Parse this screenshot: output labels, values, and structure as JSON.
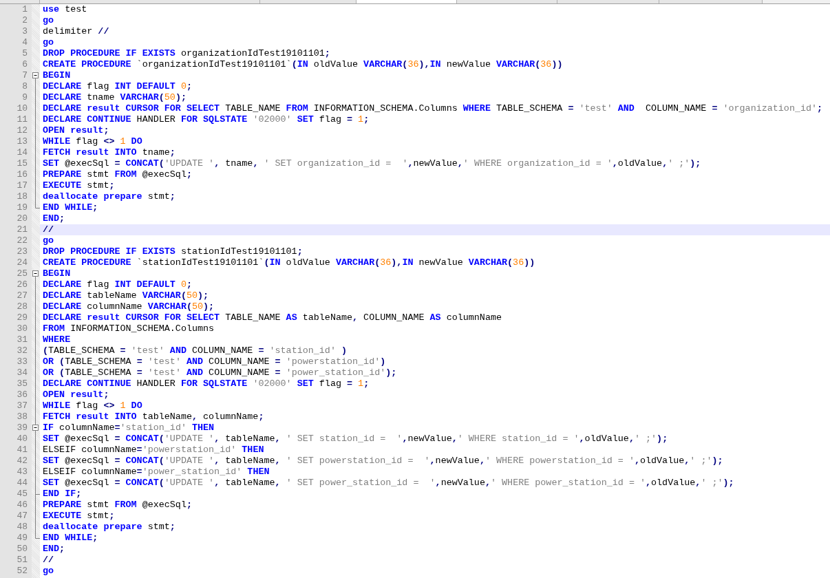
{
  "editor": {
    "lines": [
      {
        "number": "1",
        "highlighted": false,
        "tokens": [
          {
            "kind": "keyword",
            "text": "use"
          },
          {
            "kind": "plain",
            "text": " test"
          }
        ]
      },
      {
        "number": "2",
        "highlighted": false,
        "tokens": [
          {
            "kind": "keyword",
            "text": "go"
          }
        ]
      },
      {
        "number": "3",
        "highlighted": false,
        "tokens": [
          {
            "kind": "plain",
            "text": "delimiter "
          },
          {
            "kind": "operator",
            "text": "//"
          }
        ]
      },
      {
        "number": "4",
        "highlighted": false,
        "tokens": [
          {
            "kind": "keyword",
            "text": "go"
          }
        ]
      },
      {
        "number": "5",
        "highlighted": false,
        "tokens": [
          {
            "kind": "keyword",
            "text": "DROP PROCEDURE IF EXISTS"
          },
          {
            "kind": "plain",
            "text": " organizationIdTest19101101"
          },
          {
            "kind": "operator",
            "text": ";"
          }
        ]
      },
      {
        "number": "6",
        "highlighted": false,
        "tokens": [
          {
            "kind": "keyword",
            "text": "CREATE PROCEDURE"
          },
          {
            "kind": "plain",
            "text": " `organizationIdTest19101101`"
          },
          {
            "kind": "operator",
            "text": "("
          },
          {
            "kind": "keyword",
            "text": "IN"
          },
          {
            "kind": "plain",
            "text": " oldValue "
          },
          {
            "kind": "keyword",
            "text": "VARCHAR"
          },
          {
            "kind": "operator",
            "text": "("
          },
          {
            "kind": "number",
            "text": "36"
          },
          {
            "kind": "operator",
            "text": "),"
          },
          {
            "kind": "keyword",
            "text": "IN"
          },
          {
            "kind": "plain",
            "text": " newValue "
          },
          {
            "kind": "keyword",
            "text": "VARCHAR"
          },
          {
            "kind": "operator",
            "text": "("
          },
          {
            "kind": "number",
            "text": "36"
          },
          {
            "kind": "operator",
            "text": "))"
          }
        ]
      },
      {
        "number": "7",
        "kind": "fold-start",
        "highlighted": false,
        "tokens": [
          {
            "kind": "keyword",
            "text": "BEGIN"
          }
        ]
      },
      {
        "number": "8",
        "kind": "fold-line",
        "highlighted": false,
        "tokens": [
          {
            "kind": "keyword",
            "text": "DECLARE"
          },
          {
            "kind": "plain",
            "text": " flag "
          },
          {
            "kind": "keyword",
            "text": "INT DEFAULT "
          },
          {
            "kind": "number",
            "text": "0"
          },
          {
            "kind": "operator",
            "text": ";"
          }
        ]
      },
      {
        "number": "9",
        "kind": "fold-line",
        "highlighted": false,
        "tokens": [
          {
            "kind": "keyword",
            "text": "DECLARE"
          },
          {
            "kind": "plain",
            "text": " tname "
          },
          {
            "kind": "keyword",
            "text": "VARCHAR"
          },
          {
            "kind": "operator",
            "text": "("
          },
          {
            "kind": "number",
            "text": "50"
          },
          {
            "kind": "operator",
            "text": ");"
          }
        ]
      },
      {
        "number": "10",
        "kind": "fold-line",
        "highlighted": false,
        "tokens": [
          {
            "kind": "keyword",
            "text": "DECLARE result CURSOR FOR SELECT"
          },
          {
            "kind": "plain",
            "text": " TABLE_NAME "
          },
          {
            "kind": "keyword",
            "text": "FROM"
          },
          {
            "kind": "plain",
            "text": " INFORMATION_SCHEMA.Columns "
          },
          {
            "kind": "keyword",
            "text": "WHERE"
          },
          {
            "kind": "plain",
            "text": " TABLE_SCHEMA "
          },
          {
            "kind": "operator",
            "text": "= "
          },
          {
            "kind": "string",
            "text": "'test' "
          },
          {
            "kind": "keyword",
            "text": "AND"
          },
          {
            "kind": "plain",
            "text": "  COLUMN_NAME "
          },
          {
            "kind": "operator",
            "text": "= "
          },
          {
            "kind": "string",
            "text": "'organization_id'"
          },
          {
            "kind": "operator",
            "text": ";"
          }
        ]
      },
      {
        "number": "11",
        "kind": "fold-line",
        "highlighted": false,
        "tokens": [
          {
            "kind": "keyword",
            "text": "DECLARE CONTINUE"
          },
          {
            "kind": "plain",
            "text": " HANDLER "
          },
          {
            "kind": "keyword",
            "text": "FOR SQLSTATE "
          },
          {
            "kind": "string",
            "text": "'02000' "
          },
          {
            "kind": "keyword",
            "text": "SET"
          },
          {
            "kind": "plain",
            "text": " flag "
          },
          {
            "kind": "operator",
            "text": "= "
          },
          {
            "kind": "number",
            "text": "1"
          },
          {
            "kind": "operator",
            "text": ";"
          }
        ]
      },
      {
        "number": "12",
        "kind": "fold-line",
        "highlighted": false,
        "tokens": [
          {
            "kind": "keyword",
            "text": "OPEN result"
          },
          {
            "kind": "operator",
            "text": ";"
          }
        ]
      },
      {
        "number": "13",
        "kind": "fold-line",
        "highlighted": false,
        "tokens": [
          {
            "kind": "keyword",
            "text": "WHILE"
          },
          {
            "kind": "plain",
            "text": " flag "
          },
          {
            "kind": "operator",
            "text": "<> "
          },
          {
            "kind": "number",
            "text": "1 "
          },
          {
            "kind": "keyword",
            "text": "DO"
          }
        ]
      },
      {
        "number": "14",
        "kind": "fold-line",
        "highlighted": false,
        "tokens": [
          {
            "kind": "keyword",
            "text": "FETCH result INTO"
          },
          {
            "kind": "plain",
            "text": " tname"
          },
          {
            "kind": "operator",
            "text": ";"
          }
        ]
      },
      {
        "number": "15",
        "kind": "fold-line",
        "highlighted": false,
        "tokens": [
          {
            "kind": "keyword",
            "text": "SET"
          },
          {
            "kind": "plain",
            "text": " @execSql "
          },
          {
            "kind": "operator",
            "text": "= "
          },
          {
            "kind": "keyword",
            "text": "CONCAT"
          },
          {
            "kind": "operator",
            "text": "("
          },
          {
            "kind": "string",
            "text": "'UPDATE '"
          },
          {
            "kind": "operator",
            "text": ","
          },
          {
            "kind": "plain",
            "text": " tname"
          },
          {
            "kind": "operator",
            "text": ", "
          },
          {
            "kind": "string",
            "text": "' SET organization_id =  '"
          },
          {
            "kind": "operator",
            "text": ","
          },
          {
            "kind": "plain",
            "text": "newValue"
          },
          {
            "kind": "operator",
            "text": ","
          },
          {
            "kind": "string",
            "text": "' WHERE organization_id = '"
          },
          {
            "kind": "operator",
            "text": ","
          },
          {
            "kind": "plain",
            "text": "oldValue"
          },
          {
            "kind": "operator",
            "text": ","
          },
          {
            "kind": "string",
            "text": "' ;'"
          },
          {
            "kind": "operator",
            "text": ");"
          }
        ]
      },
      {
        "number": "16",
        "kind": "fold-line",
        "highlighted": false,
        "tokens": [
          {
            "kind": "keyword",
            "text": "PREPARE"
          },
          {
            "kind": "plain",
            "text": " stmt "
          },
          {
            "kind": "keyword",
            "text": "FROM"
          },
          {
            "kind": "plain",
            "text": " @execSql"
          },
          {
            "kind": "operator",
            "text": ";"
          }
        ]
      },
      {
        "number": "17",
        "kind": "fold-line",
        "highlighted": false,
        "tokens": [
          {
            "kind": "keyword",
            "text": "EXECUTE"
          },
          {
            "kind": "plain",
            "text": " stmt"
          },
          {
            "kind": "operator",
            "text": ";"
          }
        ]
      },
      {
        "number": "18",
        "kind": "fold-line",
        "highlighted": false,
        "tokens": [
          {
            "kind": "keyword",
            "text": "deallocate prepare"
          },
          {
            "kind": "plain",
            "text": " stmt"
          },
          {
            "kind": "operator",
            "text": ";"
          }
        ]
      },
      {
        "number": "19",
        "kind": "fold-end",
        "highlighted": false,
        "tokens": [
          {
            "kind": "keyword",
            "text": "END WHILE"
          },
          {
            "kind": "operator",
            "text": ";"
          }
        ]
      },
      {
        "number": "20",
        "highlighted": false,
        "tokens": [
          {
            "kind": "keyword",
            "text": "END"
          },
          {
            "kind": "operator",
            "text": ";"
          }
        ]
      },
      {
        "number": "21",
        "highlighted": true,
        "tokens": [
          {
            "kind": "operator",
            "text": "//"
          }
        ]
      },
      {
        "number": "22",
        "highlighted": false,
        "tokens": [
          {
            "kind": "keyword",
            "text": "go"
          }
        ]
      },
      {
        "number": "23",
        "highlighted": false,
        "tokens": [
          {
            "kind": "keyword",
            "text": "DROP PROCEDURE IF EXISTS"
          },
          {
            "kind": "plain",
            "text": " stationIdTest19101101"
          },
          {
            "kind": "operator",
            "text": ";"
          }
        ]
      },
      {
        "number": "24",
        "highlighted": false,
        "tokens": [
          {
            "kind": "keyword",
            "text": "CREATE PROCEDURE"
          },
          {
            "kind": "plain",
            "text": " `stationIdTest19101101`"
          },
          {
            "kind": "operator",
            "text": "("
          },
          {
            "kind": "keyword",
            "text": "IN"
          },
          {
            "kind": "plain",
            "text": " oldValue "
          },
          {
            "kind": "keyword",
            "text": "VARCHAR"
          },
          {
            "kind": "operator",
            "text": "("
          },
          {
            "kind": "number",
            "text": "36"
          },
          {
            "kind": "operator",
            "text": "),"
          },
          {
            "kind": "keyword",
            "text": "IN"
          },
          {
            "kind": "plain",
            "text": " newValue "
          },
          {
            "kind": "keyword",
            "text": "VARCHAR"
          },
          {
            "kind": "operator",
            "text": "("
          },
          {
            "kind": "number",
            "text": "36"
          },
          {
            "kind": "operator",
            "text": "))"
          }
        ]
      },
      {
        "number": "25",
        "kind": "fold-start",
        "highlighted": false,
        "tokens": [
          {
            "kind": "keyword",
            "text": "BEGIN"
          }
        ]
      },
      {
        "number": "26",
        "kind": "fold-line",
        "highlighted": false,
        "tokens": [
          {
            "kind": "keyword",
            "text": "DECLARE"
          },
          {
            "kind": "plain",
            "text": " flag "
          },
          {
            "kind": "keyword",
            "text": "INT DEFAULT "
          },
          {
            "kind": "number",
            "text": "0"
          },
          {
            "kind": "operator",
            "text": ";"
          }
        ]
      },
      {
        "number": "27",
        "kind": "fold-line",
        "highlighted": false,
        "tokens": [
          {
            "kind": "keyword",
            "text": "DECLARE"
          },
          {
            "kind": "plain",
            "text": " tableName "
          },
          {
            "kind": "keyword",
            "text": "VARCHAR"
          },
          {
            "kind": "operator",
            "text": "("
          },
          {
            "kind": "number",
            "text": "50"
          },
          {
            "kind": "operator",
            "text": ");"
          }
        ]
      },
      {
        "number": "28",
        "kind": "fold-line",
        "highlighted": false,
        "tokens": [
          {
            "kind": "keyword",
            "text": "DECLARE"
          },
          {
            "kind": "plain",
            "text": " columnName "
          },
          {
            "kind": "keyword",
            "text": "VARCHAR"
          },
          {
            "kind": "operator",
            "text": "("
          },
          {
            "kind": "number",
            "text": "50"
          },
          {
            "kind": "operator",
            "text": ");"
          }
        ]
      },
      {
        "number": "29",
        "kind": "fold-line",
        "highlighted": false,
        "tokens": [
          {
            "kind": "keyword",
            "text": "DECLARE result CURSOR FOR SELECT"
          },
          {
            "kind": "plain",
            "text": " TABLE_NAME "
          },
          {
            "kind": "keyword",
            "text": "AS"
          },
          {
            "kind": "plain",
            "text": " tableName"
          },
          {
            "kind": "operator",
            "text": ","
          },
          {
            "kind": "plain",
            "text": " COLUMN_NAME "
          },
          {
            "kind": "keyword",
            "text": "AS"
          },
          {
            "kind": "plain",
            "text": " columnName"
          }
        ]
      },
      {
        "number": "30",
        "kind": "fold-line",
        "highlighted": false,
        "tokens": [
          {
            "kind": "keyword",
            "text": "FROM"
          },
          {
            "kind": "plain",
            "text": " INFORMATION_SCHEMA.Columns"
          }
        ]
      },
      {
        "number": "31",
        "kind": "fold-line",
        "highlighted": false,
        "tokens": [
          {
            "kind": "keyword",
            "text": "WHERE"
          }
        ]
      },
      {
        "number": "32",
        "kind": "fold-line",
        "highlighted": false,
        "tokens": [
          {
            "kind": "operator",
            "text": "("
          },
          {
            "kind": "plain",
            "text": "TABLE_SCHEMA "
          },
          {
            "kind": "operator",
            "text": "= "
          },
          {
            "kind": "string",
            "text": "'test' "
          },
          {
            "kind": "keyword",
            "text": "AND"
          },
          {
            "kind": "plain",
            "text": " COLUMN_NAME "
          },
          {
            "kind": "operator",
            "text": "= "
          },
          {
            "kind": "string",
            "text": "'station_id' "
          },
          {
            "kind": "operator",
            "text": ")"
          }
        ]
      },
      {
        "number": "33",
        "kind": "fold-line",
        "highlighted": false,
        "tokens": [
          {
            "kind": "keyword",
            "text": "OR "
          },
          {
            "kind": "operator",
            "text": "("
          },
          {
            "kind": "plain",
            "text": "TABLE_SCHEMA "
          },
          {
            "kind": "operator",
            "text": "= "
          },
          {
            "kind": "string",
            "text": "'test' "
          },
          {
            "kind": "keyword",
            "text": "AND"
          },
          {
            "kind": "plain",
            "text": " COLUMN_NAME "
          },
          {
            "kind": "operator",
            "text": "= "
          },
          {
            "kind": "string",
            "text": "'powerstation_id'"
          },
          {
            "kind": "operator",
            "text": ")"
          }
        ]
      },
      {
        "number": "34",
        "kind": "fold-line",
        "highlighted": false,
        "tokens": [
          {
            "kind": "keyword",
            "text": "OR "
          },
          {
            "kind": "operator",
            "text": "("
          },
          {
            "kind": "plain",
            "text": "TABLE_SCHEMA "
          },
          {
            "kind": "operator",
            "text": "= "
          },
          {
            "kind": "string",
            "text": "'test' "
          },
          {
            "kind": "keyword",
            "text": "AND"
          },
          {
            "kind": "plain",
            "text": " COLUMN_NAME "
          },
          {
            "kind": "operator",
            "text": "= "
          },
          {
            "kind": "string",
            "text": "'power_station_id'"
          },
          {
            "kind": "operator",
            "text": ");"
          }
        ]
      },
      {
        "number": "35",
        "kind": "fold-line",
        "highlighted": false,
        "tokens": [
          {
            "kind": "keyword",
            "text": "DECLARE CONTINUE"
          },
          {
            "kind": "plain",
            "text": " HANDLER "
          },
          {
            "kind": "keyword",
            "text": "FOR SQLSTATE "
          },
          {
            "kind": "string",
            "text": "'02000' "
          },
          {
            "kind": "keyword",
            "text": "SET"
          },
          {
            "kind": "plain",
            "text": " flag "
          },
          {
            "kind": "operator",
            "text": "= "
          },
          {
            "kind": "number",
            "text": "1"
          },
          {
            "kind": "operator",
            "text": ";"
          }
        ]
      },
      {
        "number": "36",
        "kind": "fold-line",
        "highlighted": false,
        "tokens": [
          {
            "kind": "keyword",
            "text": "OPEN result"
          },
          {
            "kind": "operator",
            "text": ";"
          }
        ]
      },
      {
        "number": "37",
        "kind": "fold-line",
        "highlighted": false,
        "tokens": [
          {
            "kind": "keyword",
            "text": "WHILE"
          },
          {
            "kind": "plain",
            "text": " flag "
          },
          {
            "kind": "operator",
            "text": "<> "
          },
          {
            "kind": "number",
            "text": "1 "
          },
          {
            "kind": "keyword",
            "text": "DO"
          }
        ]
      },
      {
        "number": "38",
        "kind": "fold-line",
        "highlighted": false,
        "tokens": [
          {
            "kind": "keyword",
            "text": "FETCH result INTO"
          },
          {
            "kind": "plain",
            "text": " tableName"
          },
          {
            "kind": "operator",
            "text": ","
          },
          {
            "kind": "plain",
            "text": " columnName"
          },
          {
            "kind": "operator",
            "text": ";"
          }
        ]
      },
      {
        "number": "39",
        "kind": "fold-inner-start",
        "highlighted": false,
        "tokens": [
          {
            "kind": "keyword",
            "text": "IF"
          },
          {
            "kind": "plain",
            "text": " columnName"
          },
          {
            "kind": "operator",
            "text": "="
          },
          {
            "kind": "string",
            "text": "'station_id' "
          },
          {
            "kind": "keyword",
            "text": "THEN"
          }
        ]
      },
      {
        "number": "40",
        "kind": "fold-line",
        "highlighted": false,
        "tokens": [
          {
            "kind": "keyword",
            "text": "SET"
          },
          {
            "kind": "plain",
            "text": " @execSql "
          },
          {
            "kind": "operator",
            "text": "= "
          },
          {
            "kind": "keyword",
            "text": "CONCAT"
          },
          {
            "kind": "operator",
            "text": "("
          },
          {
            "kind": "string",
            "text": "'UPDATE '"
          },
          {
            "kind": "operator",
            "text": ","
          },
          {
            "kind": "plain",
            "text": " tableName"
          },
          {
            "kind": "operator",
            "text": ", "
          },
          {
            "kind": "string",
            "text": "' SET station_id =  '"
          },
          {
            "kind": "operator",
            "text": ","
          },
          {
            "kind": "plain",
            "text": "newValue"
          },
          {
            "kind": "operator",
            "text": ","
          },
          {
            "kind": "string",
            "text": "' WHERE station_id = '"
          },
          {
            "kind": "operator",
            "text": ","
          },
          {
            "kind": "plain",
            "text": "oldValue"
          },
          {
            "kind": "operator",
            "text": ","
          },
          {
            "kind": "string",
            "text": "' ;'"
          },
          {
            "kind": "operator",
            "text": ");"
          }
        ]
      },
      {
        "number": "41",
        "kind": "fold-line",
        "highlighted": false,
        "tokens": [
          {
            "kind": "plain",
            "text": "ELSEIF columnName"
          },
          {
            "kind": "operator",
            "text": "="
          },
          {
            "kind": "string",
            "text": "'powerstation_id' "
          },
          {
            "kind": "keyword",
            "text": "THEN"
          }
        ]
      },
      {
        "number": "42",
        "kind": "fold-line",
        "highlighted": false,
        "tokens": [
          {
            "kind": "keyword",
            "text": "SET"
          },
          {
            "kind": "plain",
            "text": " @execSql "
          },
          {
            "kind": "operator",
            "text": "= "
          },
          {
            "kind": "keyword",
            "text": "CONCAT"
          },
          {
            "kind": "operator",
            "text": "("
          },
          {
            "kind": "string",
            "text": "'UPDATE '"
          },
          {
            "kind": "operator",
            "text": ","
          },
          {
            "kind": "plain",
            "text": " tableName"
          },
          {
            "kind": "operator",
            "text": ", "
          },
          {
            "kind": "string",
            "text": "' SET powerstation_id =  '"
          },
          {
            "kind": "operator",
            "text": ","
          },
          {
            "kind": "plain",
            "text": "newValue"
          },
          {
            "kind": "operator",
            "text": ","
          },
          {
            "kind": "string",
            "text": "' WHERE powerstation_id = '"
          },
          {
            "kind": "operator",
            "text": ","
          },
          {
            "kind": "plain",
            "text": "oldValue"
          },
          {
            "kind": "operator",
            "text": ","
          },
          {
            "kind": "string",
            "text": "' ;'"
          },
          {
            "kind": "operator",
            "text": ");"
          }
        ]
      },
      {
        "number": "43",
        "kind": "fold-line",
        "highlighted": false,
        "tokens": [
          {
            "kind": "plain",
            "text": "ELSEIF columnName"
          },
          {
            "kind": "operator",
            "text": "="
          },
          {
            "kind": "string",
            "text": "'power_station_id' "
          },
          {
            "kind": "keyword",
            "text": "THEN"
          }
        ]
      },
      {
        "number": "44",
        "kind": "fold-line",
        "highlighted": false,
        "tokens": [
          {
            "kind": "keyword",
            "text": "SET"
          },
          {
            "kind": "plain",
            "text": " @execSql "
          },
          {
            "kind": "operator",
            "text": "= "
          },
          {
            "kind": "keyword",
            "text": "CONCAT"
          },
          {
            "kind": "operator",
            "text": "("
          },
          {
            "kind": "string",
            "text": "'UPDATE '"
          },
          {
            "kind": "operator",
            "text": ","
          },
          {
            "kind": "plain",
            "text": " tableName"
          },
          {
            "kind": "operator",
            "text": ", "
          },
          {
            "kind": "string",
            "text": "' SET power_station_id =  '"
          },
          {
            "kind": "operator",
            "text": ","
          },
          {
            "kind": "plain",
            "text": "newValue"
          },
          {
            "kind": "operator",
            "text": ","
          },
          {
            "kind": "string",
            "text": "' WHERE power_station_id = '"
          },
          {
            "kind": "operator",
            "text": ","
          },
          {
            "kind": "plain",
            "text": "oldValue"
          },
          {
            "kind": "operator",
            "text": ","
          },
          {
            "kind": "string",
            "text": "' ;'"
          },
          {
            "kind": "operator",
            "text": ");"
          }
        ]
      },
      {
        "number": "45",
        "kind": "fold-inner-end",
        "highlighted": false,
        "tokens": [
          {
            "kind": "keyword",
            "text": "END IF"
          },
          {
            "kind": "operator",
            "text": ";"
          }
        ]
      },
      {
        "number": "46",
        "kind": "fold-line",
        "highlighted": false,
        "tokens": [
          {
            "kind": "keyword",
            "text": "PREPARE"
          },
          {
            "kind": "plain",
            "text": " stmt "
          },
          {
            "kind": "keyword",
            "text": "FROM"
          },
          {
            "kind": "plain",
            "text": " @execSql"
          },
          {
            "kind": "operator",
            "text": ";"
          }
        ]
      },
      {
        "number": "47",
        "kind": "fold-line",
        "highlighted": false,
        "tokens": [
          {
            "kind": "keyword",
            "text": "EXECUTE"
          },
          {
            "kind": "plain",
            "text": " stmt"
          },
          {
            "kind": "operator",
            "text": ";"
          }
        ]
      },
      {
        "number": "48",
        "kind": "fold-line",
        "highlighted": false,
        "tokens": [
          {
            "kind": "keyword",
            "text": "deallocate prepare"
          },
          {
            "kind": "plain",
            "text": " stmt"
          },
          {
            "kind": "operator",
            "text": ";"
          }
        ]
      },
      {
        "number": "49",
        "kind": "fold-end",
        "highlighted": false,
        "tokens": [
          {
            "kind": "keyword",
            "text": "END WHILE"
          },
          {
            "kind": "operator",
            "text": ";"
          }
        ]
      },
      {
        "number": "50",
        "highlighted": false,
        "tokens": [
          {
            "kind": "keyword",
            "text": "END"
          },
          {
            "kind": "operator",
            "text": ";"
          }
        ]
      },
      {
        "number": "51",
        "highlighted": false,
        "tokens": [
          {
            "kind": "operator",
            "text": "//"
          }
        ]
      },
      {
        "number": "52",
        "highlighted": false,
        "tokens": [
          {
            "kind": "keyword",
            "text": "go"
          }
        ]
      }
    ]
  }
}
